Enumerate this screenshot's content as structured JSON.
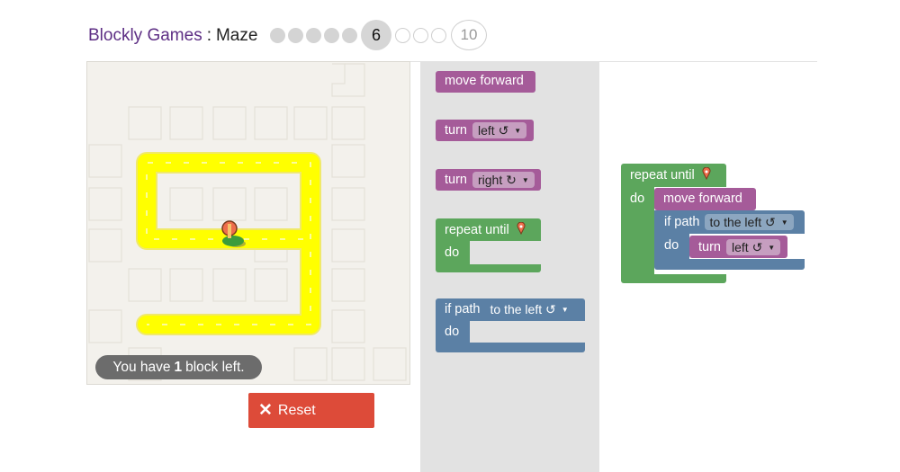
{
  "header": {
    "app_name": "Blockly Games",
    "separator": ":",
    "game_name": "Maze",
    "current_level": "6",
    "last_level": "10"
  },
  "maze": {
    "capacity_prefix": "You have",
    "capacity_count": "1",
    "capacity_suffix": "block left.",
    "path_color": "#ffff00",
    "pegman_icon": "pegman-avatar"
  },
  "controls": {
    "reset_label": "Reset",
    "reset_icon": "close-icon",
    "reset_color": "#dd4b39"
  },
  "toolbox": {
    "move_forward": "move forward",
    "turn_left_label": "turn",
    "turn_left_dir": "left ↺",
    "turn_right_label": "turn",
    "turn_right_dir": "right ↻",
    "repeat_until": "repeat until",
    "repeat_do": "do",
    "if_path": "if path",
    "if_dir": "to the left ↺",
    "if_do": "do"
  },
  "workspace": {
    "repeat_until": "repeat until",
    "repeat_do": "do",
    "move_forward": "move forward",
    "if_path": "if path",
    "if_dir": "to the left ↺",
    "if_do": "do",
    "turn_label": "turn",
    "turn_dir": "left ↺"
  },
  "colors": {
    "motion_block": "#a55b99",
    "loop_block": "#5ca65c",
    "logic_block": "#5b80a5",
    "title_link": "#5d2e84"
  }
}
